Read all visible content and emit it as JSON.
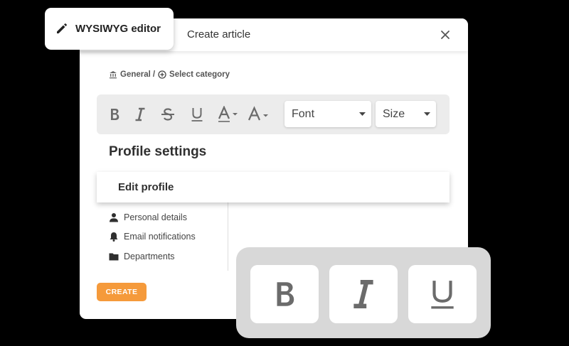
{
  "tag": {
    "label": "WYSIWYG editor",
    "icon": "pencil-icon"
  },
  "dialog": {
    "title": "Create article",
    "close_icon": "close-icon"
  },
  "breadcrumb": {
    "home_label": "General",
    "separator": "/",
    "add_label": "Select category"
  },
  "toolbar": {
    "buttons": [
      "bold-icon",
      "italic-icon",
      "strikethrough-icon",
      "underline-icon",
      "font-color-icon",
      "font-size-icon"
    ],
    "font_select": {
      "value": "Font"
    },
    "size_select": {
      "value": "Size"
    }
  },
  "section_title": "Profile settings",
  "edit_profile": "Edit profile",
  "nav": [
    {
      "label": "Personal details",
      "icon": "person-icon"
    },
    {
      "label": "Email notifications",
      "icon": "bell-icon"
    },
    {
      "label": "Departments",
      "icon": "folder-icon"
    }
  ],
  "create_label": "CREATE",
  "format_panel": [
    "bold-icon",
    "italic-icon",
    "underline-icon"
  ],
  "colors": {
    "background": "#000000",
    "accent": "#f59a3b",
    "toolbar": "#ececec",
    "panel": "#d8d8d8",
    "icon": "#6b6b6b"
  }
}
